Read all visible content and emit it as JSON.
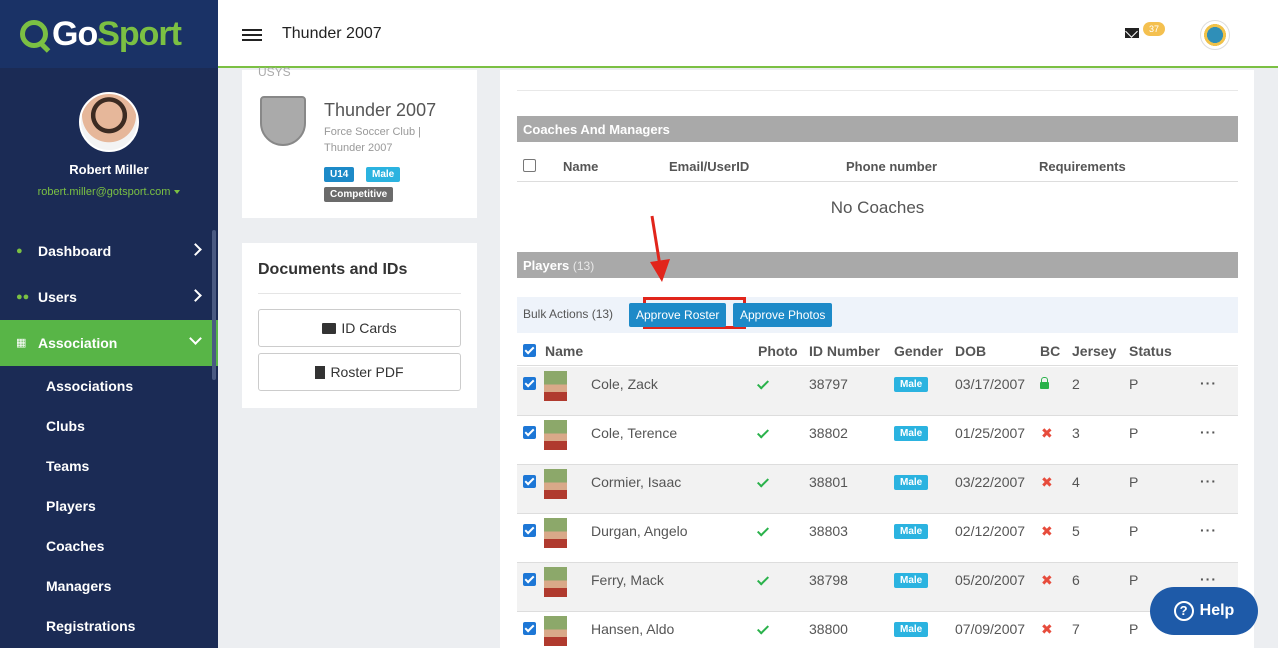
{
  "app": {
    "logo_prefix": "Go",
    "logo_suffix": "Sport",
    "page_title": "Thunder 2007"
  },
  "header": {
    "mail_count": "37"
  },
  "profile": {
    "name": "Robert Miller",
    "email": "robert.miller@gotsport.com"
  },
  "nav": {
    "items": [
      {
        "label": "Dashboard",
        "icon": "dashboard-icon"
      },
      {
        "label": "Users",
        "icon": "users-icon"
      },
      {
        "label": "Association",
        "icon": "sitemap-icon"
      }
    ],
    "sub_items": [
      "Associations",
      "Clubs",
      "Teams",
      "Players",
      "Coaches",
      "Managers",
      "Registrations"
    ]
  },
  "team": {
    "org": "USYS",
    "name": "Thunder 2007",
    "club": "Force Soccer Club | Thunder 2007",
    "age": "U14",
    "gender": "Male",
    "level": "Competitive"
  },
  "docs": {
    "title": "Documents and IDs",
    "id_cards": "ID Cards",
    "roster_pdf": "Roster PDF"
  },
  "coaches": {
    "title": "Coaches And Managers",
    "columns": [
      "Name",
      "Email/UserID",
      "Phone number",
      "Requirements"
    ],
    "empty": "No Coaches"
  },
  "players": {
    "title": "Players",
    "count": "(13)",
    "bulk_label": "Bulk Actions (13)",
    "approve_roster": "Approve Roster",
    "approve_photos": "Approve Photos",
    "columns": [
      "Name",
      "Photo",
      "ID Number",
      "Gender",
      "DOB",
      "BC",
      "Jersey",
      "Status"
    ],
    "rows": [
      {
        "name": "Cole, Zack",
        "id": "38797",
        "gender": "Male",
        "dob": "03/17/2007",
        "bc": "lock",
        "jersey": "2",
        "status": "P"
      },
      {
        "name": "Cole, Terence",
        "id": "38802",
        "gender": "Male",
        "dob": "01/25/2007",
        "bc": "x",
        "jersey": "3",
        "status": "P"
      },
      {
        "name": "Cormier, Isaac",
        "id": "38801",
        "gender": "Male",
        "dob": "03/22/2007",
        "bc": "x",
        "jersey": "4",
        "status": "P"
      },
      {
        "name": "Durgan, Angelo",
        "id": "38803",
        "gender": "Male",
        "dob": "02/12/2007",
        "bc": "x",
        "jersey": "5",
        "status": "P"
      },
      {
        "name": "Ferry, Mack",
        "id": "38798",
        "gender": "Male",
        "dob": "05/20/2007",
        "bc": "x",
        "jersey": "6",
        "status": "P"
      },
      {
        "name": "Hansen, Aldo",
        "id": "38800",
        "gender": "Male",
        "dob": "07/09/2007",
        "bc": "x",
        "jersey": "7",
        "status": "P"
      }
    ]
  },
  "help": {
    "label": "Help"
  },
  "colors": {
    "brand_green": "#7bc043",
    "sidebar": "#1b2b55",
    "active_nav": "#58b547",
    "primary_blue": "#1d8ac8",
    "highlight_red": "#e1251b"
  }
}
